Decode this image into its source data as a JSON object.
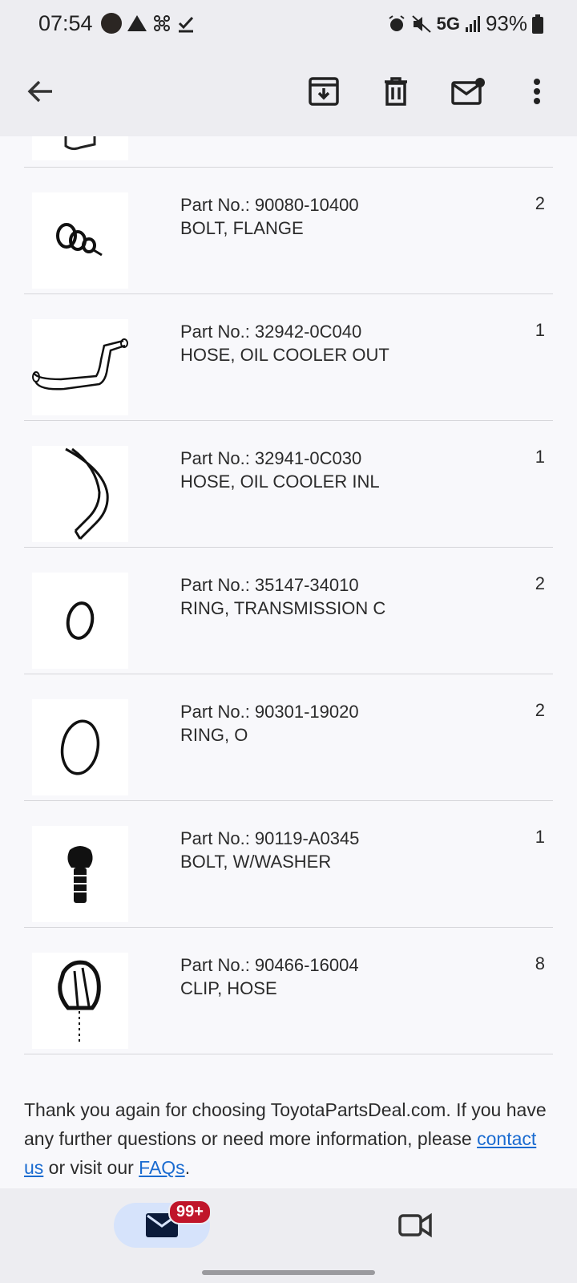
{
  "status_bar": {
    "time": "07:54",
    "network": "5G",
    "battery": "93%"
  },
  "app_bar": {
    "back_icon": "arrow-left-icon",
    "archive_icon": "archive-icon",
    "delete_icon": "trash-icon",
    "mark_unread_icon": "mark-unread-icon",
    "more_icon": "more-vert-icon"
  },
  "parts": [
    {
      "part_no": "Part No.: 90080-10400",
      "name": "BOLT, FLANGE",
      "qty": "2"
    },
    {
      "part_no": "Part No.: 32942-0C040",
      "name": "HOSE, OIL COOLER OUT",
      "qty": "1"
    },
    {
      "part_no": "Part No.: 32941-0C030",
      "name": "HOSE, OIL COOLER INL",
      "qty": "1"
    },
    {
      "part_no": "Part No.: 35147-34010",
      "name": "RING, TRANSMISSION C",
      "qty": "2"
    },
    {
      "part_no": "Part No.: 90301-19020",
      "name": "RING, O",
      "qty": "2"
    },
    {
      "part_no": "Part No.: 90119-A0345",
      "name": "BOLT, W/WASHER",
      "qty": "1"
    },
    {
      "part_no": "Part No.: 90466-16004",
      "name": "CLIP, HOSE",
      "qty": "8"
    }
  ],
  "footer": {
    "text_1": "Thank you again for choosing ToyotaPartsDeal.com. If you have any further questions or need more information, please ",
    "contact_link": "contact us",
    "text_2": " or visit our ",
    "faq_link": "FAQs",
    "text_3": "."
  },
  "bottom_nav": {
    "mail_badge": "99+",
    "mail_icon": "mail-icon",
    "meet_icon": "video-camera-icon"
  },
  "colors": {
    "link": "#1a6bd0",
    "badge": "#c0152a",
    "pill": "#d6e3fb"
  }
}
